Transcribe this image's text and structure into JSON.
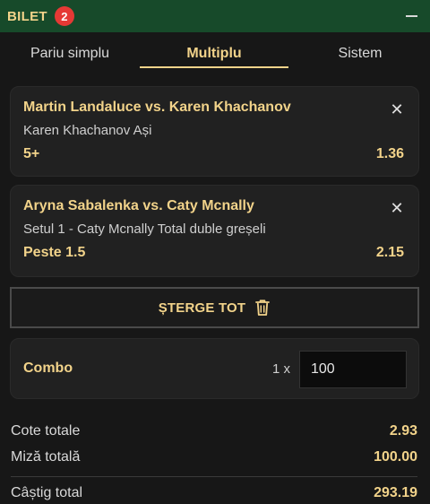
{
  "header": {
    "title": "BILET",
    "badge_count": "2",
    "accent_color": "#174a2a",
    "minimize_icon": "minus-icon"
  },
  "tabs": [
    {
      "label": "Pariu simplu",
      "active": false
    },
    {
      "label": "Multiplu",
      "active": true
    },
    {
      "label": "Sistem",
      "active": false
    }
  ],
  "bets": [
    {
      "event": "Martin Landaluce vs. Karen Khachanov",
      "market": "Karen Khachanov Ași",
      "selection": "5+",
      "odds": "1.36"
    },
    {
      "event": "Aryna Sabalenka vs. Caty Mcnally",
      "market": "Setul 1 - Caty Mcnally Total duble greșeli",
      "selection": "Peste 1.5",
      "odds": "2.15"
    }
  ],
  "clear_button": {
    "label": "ȘTERGE TOT",
    "icon": "trash-icon"
  },
  "combo": {
    "label": "Combo",
    "multiplier": "1 x",
    "stake_value": "100"
  },
  "summary": {
    "total_odds_label": "Cote totale",
    "total_odds_value": "2.93",
    "total_stake_label": "Miză totală",
    "total_stake_value": "100.00",
    "total_win_label": "Câștig total",
    "total_win_value": "293.19"
  },
  "colors": {
    "gold": "#f2d38a",
    "card_bg": "#212121",
    "page_bg": "#171717",
    "badge_red": "#e53935"
  }
}
